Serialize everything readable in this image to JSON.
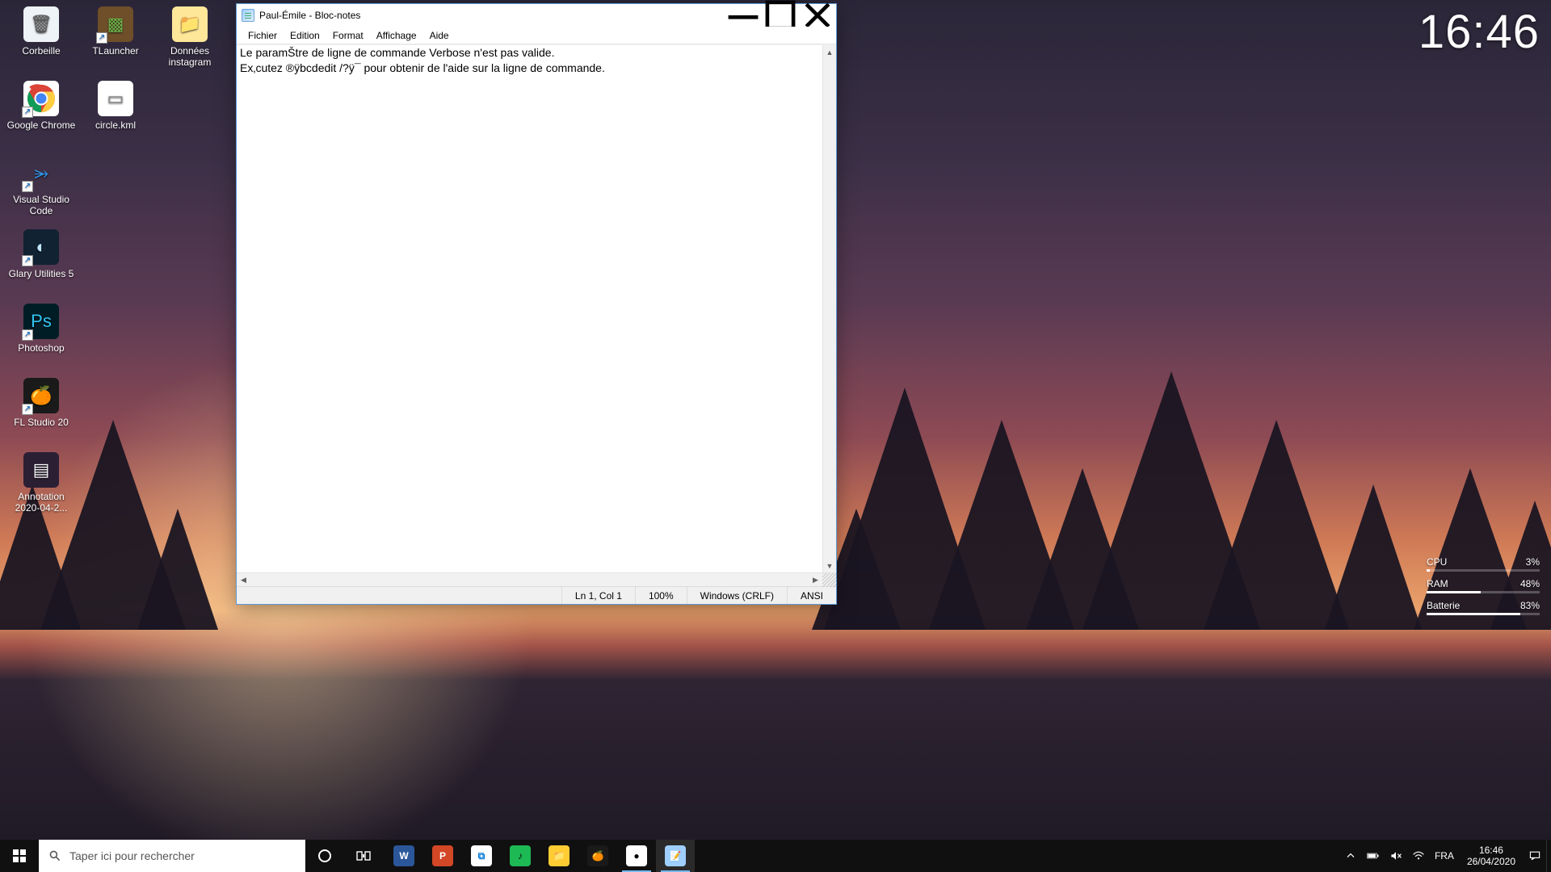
{
  "desktop_icons": [
    {
      "id": "recycle-bin",
      "label": "Corbeille",
      "row": 0,
      "col": 0,
      "shortcut": false,
      "bg": "#eef3f7",
      "fg": "#555",
      "glyph": "🗑"
    },
    {
      "id": "tlauncher",
      "label": "TLauncher",
      "row": 0,
      "col": 1,
      "shortcut": true,
      "bg": "#6f4f2a",
      "fg": "#6db34a",
      "glyph": "▩"
    },
    {
      "id": "donnees-ig",
      "label": "Données instagram",
      "row": 0,
      "col": 2,
      "shortcut": false,
      "bg": "#ffe79a",
      "fg": "#b48a00",
      "glyph": "📁"
    },
    {
      "id": "chrome",
      "label": "Google Chrome",
      "row": 1,
      "col": 0,
      "shortcut": true,
      "bg": "#ffffff",
      "fg": "#000",
      "glyph": "chrome"
    },
    {
      "id": "circle-kml",
      "label": "circle.kml",
      "row": 1,
      "col": 1,
      "shortcut": false,
      "bg": "#ffffff",
      "fg": "#888",
      "glyph": "▭"
    },
    {
      "id": "vscode",
      "label": "Visual Studio Code",
      "row": 2,
      "col": 0,
      "shortcut": true,
      "bg": "transparent",
      "fg": "#2f9cf3",
      "glyph": "⭃"
    },
    {
      "id": "glary",
      "label": "Glary Utilities 5",
      "row": 3,
      "col": 0,
      "shortcut": true,
      "bg": "#123",
      "fg": "#bfe6ff",
      "glyph": "◐"
    },
    {
      "id": "photoshop",
      "label": "Photoshop",
      "row": 4,
      "col": 0,
      "shortcut": true,
      "bg": "#001d26",
      "fg": "#31c5f0",
      "glyph": "Ps"
    },
    {
      "id": "flstudio",
      "label": "FL Studio 20",
      "row": 5,
      "col": 0,
      "shortcut": true,
      "bg": "#1a1a1a",
      "fg": "#f7a400",
      "glyph": "🍊"
    },
    {
      "id": "annotation",
      "label": "Annotation 2020-04-2...",
      "row": 6,
      "col": 0,
      "shortcut": false,
      "bg": "#2b1f34",
      "fg": "#fff",
      "glyph": "▤"
    }
  ],
  "big_clock": "16:46",
  "meters": {
    "cpu": {
      "label": "CPU",
      "value": "3%",
      "pct": 3
    },
    "ram": {
      "label": "RAM",
      "value": "48%",
      "pct": 48
    },
    "bat": {
      "label": "Batterie",
      "value": "83%",
      "pct": 83
    }
  },
  "notepad": {
    "title": "Paul-Émile - Bloc-notes",
    "menus": {
      "file": "Fichier",
      "edit": "Edition",
      "format": "Format",
      "view": "Affichage",
      "help": "Aide"
    },
    "content_line1": "Le paramŠtre de ligne de commande Verbose n'est pas valide.",
    "content_line2": "Ex‚cutez ®ÿbcdedit /?ÿ¯ pour obtenir de l'aide sur la ligne de commande.",
    "status": {
      "pos": "Ln 1, Col 1",
      "zoom": "100%",
      "eol": "Windows (CRLF)",
      "encoding": "ANSI"
    }
  },
  "taskbar": {
    "search_placeholder": "Taper ici pour rechercher",
    "apps": [
      {
        "id": "word",
        "bg": "#2b579a",
        "fg": "#fff",
        "glyph": "W",
        "running": false,
        "active": false
      },
      {
        "id": "powerpoint",
        "bg": "#d24726",
        "fg": "#fff",
        "glyph": "P",
        "running": false,
        "active": false
      },
      {
        "id": "store",
        "bg": "#ffffff",
        "fg": "#0078d7",
        "glyph": "⧉",
        "running": false,
        "active": false
      },
      {
        "id": "spotify",
        "bg": "#1db954",
        "fg": "#0b0b0b",
        "glyph": "♪",
        "running": false,
        "active": false
      },
      {
        "id": "explorer",
        "bg": "#ffcc33",
        "fg": "#1767b5",
        "glyph": "📁",
        "running": false,
        "active": false
      },
      {
        "id": "flstudio",
        "bg": "#1a1a1a",
        "fg": "#f7a400",
        "glyph": "🍊",
        "running": false,
        "active": false
      },
      {
        "id": "chrome",
        "bg": "#ffffff",
        "fg": "#000",
        "glyph": "●",
        "running": true,
        "active": false
      },
      {
        "id": "notepad",
        "bg": "#9ecfff",
        "fg": "#fff",
        "glyph": "📝",
        "running": true,
        "active": true
      }
    ],
    "lang": "FRA",
    "clock": {
      "time": "16:46",
      "date": "26/04/2020"
    }
  }
}
